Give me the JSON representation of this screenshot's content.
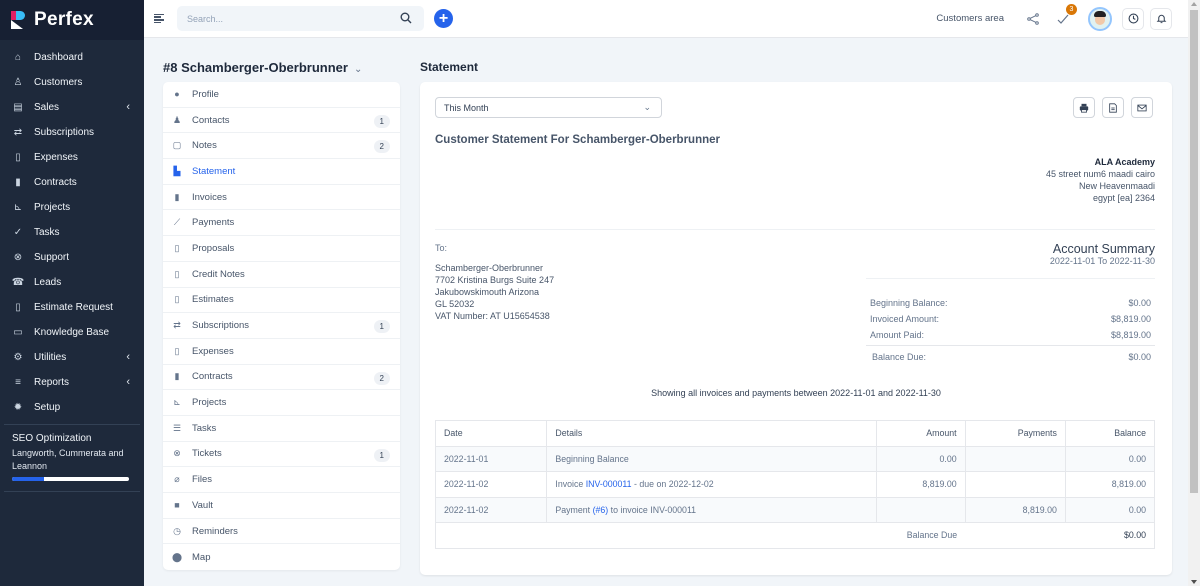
{
  "app": {
    "name": "Perfex"
  },
  "sidebar": {
    "items": [
      {
        "label": "Dashboard",
        "icon": "home-icon",
        "glyph": "⌂"
      },
      {
        "label": "Customers",
        "icon": "user-icon",
        "glyph": "♙"
      },
      {
        "label": "Sales",
        "icon": "receipt-icon",
        "glyph": "▤",
        "submenu": true
      },
      {
        "label": "Subscriptions",
        "icon": "repeat-icon",
        "glyph": "⇄"
      },
      {
        "label": "Expenses",
        "icon": "file-text-icon",
        "glyph": "▯"
      },
      {
        "label": "Contracts",
        "icon": "contract-icon",
        "glyph": "▮"
      },
      {
        "label": "Projects",
        "icon": "chart-icon",
        "glyph": "⊾"
      },
      {
        "label": "Tasks",
        "icon": "check-circle-icon",
        "glyph": "✓"
      },
      {
        "label": "Support",
        "icon": "lifebuoy-icon",
        "glyph": "⊗"
      },
      {
        "label": "Leads",
        "icon": "phone-icon",
        "glyph": "☎"
      },
      {
        "label": "Estimate Request",
        "icon": "file-icon",
        "glyph": "▯"
      },
      {
        "label": "Knowledge Base",
        "icon": "folder-icon",
        "glyph": "▭"
      },
      {
        "label": "Utilities",
        "icon": "cogs-icon",
        "glyph": "⚙",
        "submenu": true
      },
      {
        "label": "Reports",
        "icon": "bar-chart-icon",
        "glyph": "≡",
        "submenu": true
      },
      {
        "label": "Setup",
        "icon": "gear-icon",
        "glyph": "✹"
      }
    ],
    "project": {
      "title": "SEO Optimization",
      "client": "Langworth, Cummerata and Leannon",
      "progress_percent": 27
    }
  },
  "topbar": {
    "search_placeholder": "Search...",
    "customers_area": "Customers area",
    "todo_badge": "3"
  },
  "customer": {
    "title": "#8 Schamberger-Oberbrunner",
    "tabs": [
      {
        "label": "Profile",
        "icon": "user-circle-icon",
        "glyph": "●"
      },
      {
        "label": "Contacts",
        "icon": "user-icon",
        "glyph": "♟",
        "count": "1"
      },
      {
        "label": "Notes",
        "icon": "note-icon",
        "glyph": "▢",
        "count": "2"
      },
      {
        "label": "Statement",
        "icon": "area-chart-icon",
        "glyph": "▙",
        "active": true
      },
      {
        "label": "Invoices",
        "icon": "invoice-icon",
        "glyph": "▮"
      },
      {
        "label": "Payments",
        "icon": "line-chart-icon",
        "glyph": "⟋"
      },
      {
        "label": "Proposals",
        "icon": "proposal-icon",
        "glyph": "▯"
      },
      {
        "label": "Credit Notes",
        "icon": "credit-note-icon",
        "glyph": "▯"
      },
      {
        "label": "Estimates",
        "icon": "file-icon",
        "glyph": "▯"
      },
      {
        "label": "Subscriptions",
        "icon": "repeat-icon",
        "glyph": "⇄",
        "count": "1"
      },
      {
        "label": "Expenses",
        "icon": "file-text-icon",
        "glyph": "▯"
      },
      {
        "label": "Contracts",
        "icon": "contract-icon",
        "glyph": "▮",
        "count": "2"
      },
      {
        "label": "Projects",
        "icon": "chart-icon",
        "glyph": "⊾"
      },
      {
        "label": "Tasks",
        "icon": "list-check-icon",
        "glyph": "☰"
      },
      {
        "label": "Tickets",
        "icon": "lifebuoy-icon",
        "glyph": "⊗",
        "count": "1"
      },
      {
        "label": "Files",
        "icon": "paperclip-icon",
        "glyph": "⌀"
      },
      {
        "label": "Vault",
        "icon": "lock-icon",
        "glyph": "■"
      },
      {
        "label": "Reminders",
        "icon": "clock-icon",
        "glyph": "◷"
      },
      {
        "label": "Map",
        "icon": "map-pin-icon",
        "glyph": "⬤"
      }
    ]
  },
  "statement": {
    "section_title": "Statement",
    "period": "This Month",
    "heading": "Customer Statement For Schamberger-Oberbrunner",
    "company": {
      "name": "ALA Academy",
      "lines": [
        "45 street num6 maadi cairo",
        "New Heavenmaadi",
        "egypt [ea] 2364"
      ]
    },
    "to_label": "To:",
    "bill_to": [
      "Schamberger-Oberbrunner",
      "7702 Kristina Burgs Suite 247",
      "Jakubowskimouth Arizona",
      "GL 52032",
      "VAT Number: AT U15654538"
    ],
    "summary": {
      "title": "Account Summary",
      "range": "2022-11-01 To 2022-11-30",
      "rows": [
        {
          "label": "Beginning Balance:",
          "value": "$0.00"
        },
        {
          "label": "Invoiced Amount:",
          "value": "$8,819.00"
        },
        {
          "label": "Amount Paid:",
          "value": "$8,819.00"
        }
      ],
      "balance_due_label": "Balance Due:",
      "balance_due": "$0.00"
    },
    "showing": "Showing all invoices and payments between 2022-11-01 and 2022-11-30",
    "table": {
      "headers": [
        "Date",
        "Details",
        "Amount",
        "Payments",
        "Balance"
      ],
      "rows": [
        {
          "date": "2022-11-01",
          "details_pre": "Beginning Balance",
          "link": "",
          "details_post": "",
          "amount": "0.00",
          "payments": "",
          "balance": "0.00"
        },
        {
          "date": "2022-11-02",
          "details_pre": "Invoice ",
          "link": "INV-000011",
          "details_post": " - due on 2022-12-02",
          "amount": "8,819.00",
          "payments": "",
          "balance": "8,819.00"
        },
        {
          "date": "2022-11-02",
          "details_pre": "Payment ",
          "link": "(#6)",
          "details_post": " to invoice INV-000011",
          "amount": "",
          "payments": "8,819.00",
          "balance": "0.00"
        }
      ],
      "footer_label": "Balance Due",
      "footer_value": "$0.00"
    }
  }
}
